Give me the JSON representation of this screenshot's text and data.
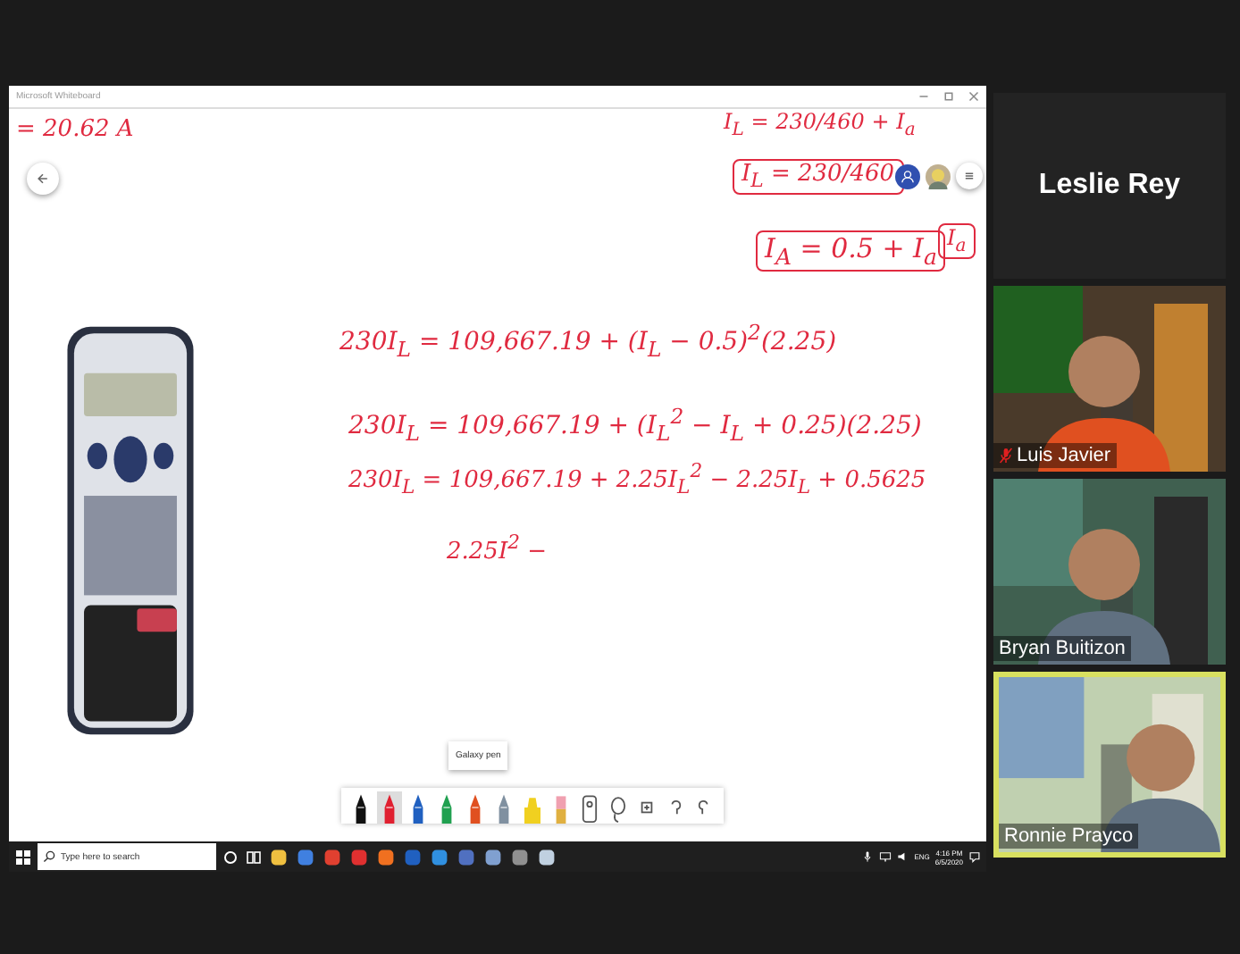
{
  "shared_screen": {
    "window_title": "Microsoft Whiteboard",
    "ink": [
      {
        "text": "= 20.62 A",
        "boxed": false
      },
      {
        "text": "I$_{L}$ = 230/460 + I$_{a}$",
        "boxed": false
      },
      {
        "text": "I$_{L}$ = 230/460",
        "boxed": true
      },
      {
        "text": "I$_{a}$",
        "boxed": true
      },
      {
        "text": "I$_{A}$ = 0.5 + I$_{a}$",
        "boxed": true
      },
      {
        "text": "230I$_{L}$ = 109,667.19 + (I$_{L}$ − 0.5)$^{2}$(2.25)",
        "boxed": false
      },
      {
        "text": "230I$_{L}$ = 109,667.19 + (I$_{L}$$^{2}$ − I$_{L}$ + 0.25)(2.25)",
        "boxed": false
      },
      {
        "text": "230I$_{L}$ = 109,667.19 + 2.25I$_{L}$$^{2}$ − 2.25I$_{L}$ + 0.5625",
        "boxed": false
      },
      {
        "text": "2.25I$^{2}$ −",
        "boxed": false
      }
    ],
    "tooltip": "Galaxy pen",
    "tools": [
      {
        "kind": "pen",
        "color": "#111111",
        "selected": false
      },
      {
        "kind": "pen",
        "color": "#e02030",
        "selected": true
      },
      {
        "kind": "pen",
        "color": "#2060c0",
        "selected": false
      },
      {
        "kind": "pen",
        "color": "#20a050",
        "selected": false
      },
      {
        "kind": "pen",
        "color": "#e05020",
        "selected": false
      },
      {
        "kind": "pen",
        "color": "#8090a0",
        "selected": false
      },
      {
        "kind": "highlighter",
        "color": "#f0d020",
        "selected": false
      },
      {
        "kind": "eraser",
        "color": "#f0a0b0",
        "selected": false
      },
      {
        "kind": "ruler",
        "selected": false
      },
      {
        "kind": "lasso",
        "selected": false
      },
      {
        "kind": "add",
        "selected": false
      },
      {
        "kind": "undo",
        "selected": false
      },
      {
        "kind": "redo",
        "selected": false
      }
    ]
  },
  "taskbar": {
    "search_placeholder": "Type here to search",
    "language": "ENG",
    "time": "4:16 PM",
    "date": "6/5/2020"
  },
  "participants": [
    {
      "name": "Leslie Rey",
      "video": false,
      "muted": false,
      "speaking": false
    },
    {
      "name": "Luis Javier",
      "video": true,
      "muted": true,
      "speaking": false
    },
    {
      "name": "Bryan Buitizon",
      "video": true,
      "muted": false,
      "speaking": false
    },
    {
      "name": "Ronnie Prayco",
      "video": true,
      "muted": false,
      "speaking": true
    }
  ]
}
